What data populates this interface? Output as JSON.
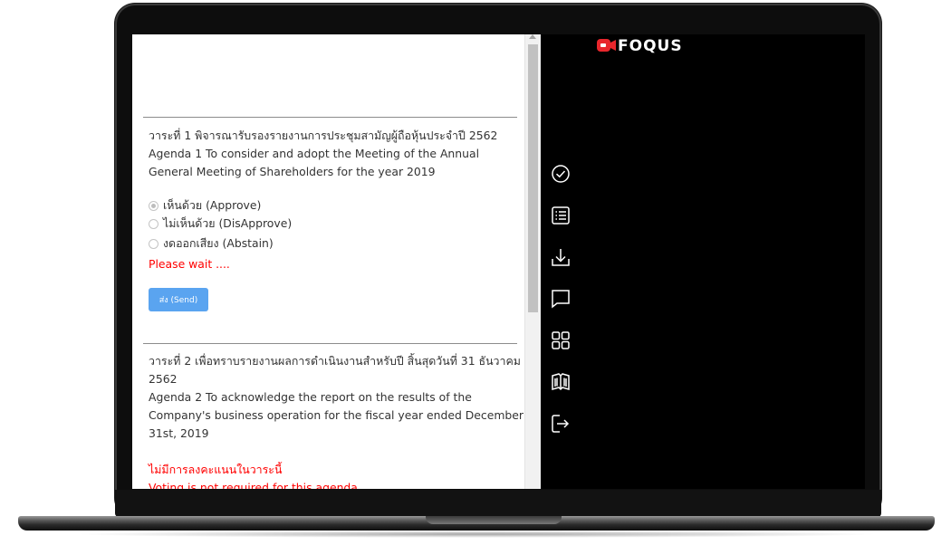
{
  "brand": {
    "logo_text": "FOQUS",
    "accent": "#e8262c"
  },
  "agendas": [
    {
      "title_th": "วาระที่ 1 พิจารณารับรองรายงานการประชุมสามัญผู้ถือหุ้นประจำปี 2562",
      "title_en": "Agenda 1 To consider and adopt the Meeting of the Annual General Meeting of Shareholders for the year 2019",
      "options": [
        {
          "label": "เห็นด้วย (Approve)",
          "selected": true
        },
        {
          "label": "ไม่เห็นด้วย (DisApprove)",
          "selected": false
        },
        {
          "label": "งดออกเสียง (Abstain)",
          "selected": false
        }
      ],
      "status": "Please wait ....",
      "send_label": "ส่ง (Send)"
    },
    {
      "title_th": "วาระที่ 2 เพื่อทราบรายงานผลการดำเนินงานสำหรับปี สิ้นสุดวันที่ 31 ธันวาคม 2562",
      "title_en": "Agenda 2 To acknowledge the report on the results of the Company's business operation for the fiscal year ended December 31st, 2019",
      "notice_th": "ไม่มีการลงคะแนนในวาระนี้",
      "notice_en": "Voting is not required for this agenda"
    }
  ],
  "toolbar": [
    {
      "icon": "check-circle-icon"
    },
    {
      "icon": "list-icon"
    },
    {
      "icon": "download-icon"
    },
    {
      "icon": "chat-icon"
    },
    {
      "icon": "grid-icon"
    },
    {
      "icon": "book-icon"
    },
    {
      "icon": "logout-icon"
    }
  ]
}
